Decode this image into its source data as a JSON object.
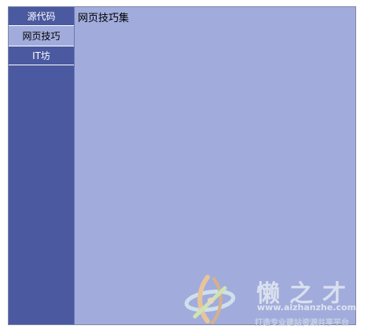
{
  "tabs": [
    {
      "label": "源代码",
      "active": false
    },
    {
      "label": "网页技巧",
      "active": true
    },
    {
      "label": "IT坊",
      "active": false
    }
  ],
  "content": {
    "title": "网页技巧集"
  },
  "watermark": {
    "brand": "懒之才",
    "url": "www.aizhanzhe.com",
    "slogan": "打造专业建站资源共享平台"
  },
  "colors": {
    "sidebar": "#4a59a0",
    "active_tab": "#a1acdc",
    "content_bg": "#a1acdc"
  }
}
